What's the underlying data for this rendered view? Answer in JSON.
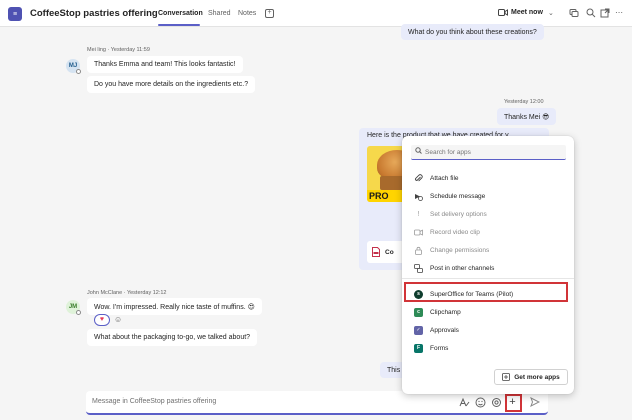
{
  "header": {
    "team_initial": "≡",
    "title": "CoffeeStop pastries offering",
    "tabs": [
      "Conversation",
      "Shared",
      "Notes"
    ],
    "meet_now": "Meet now"
  },
  "messages": {
    "top_mine": "What do you think about these creations?",
    "mei": {
      "initials": "MJ",
      "meta": "Mei ling  ·  Yesterday 11:59",
      "msg1": "Thanks Emma and team! This looks fantastic!",
      "msg2": "Do you have more details on the ingredients etc.?"
    },
    "reply": {
      "time": "Yesterday 12:00",
      "text": "Thanks Mei 😎"
    },
    "card": {
      "text": "Here is the product that we have created for y",
      "image_band": "PRO",
      "file_label": "Co"
    },
    "john": {
      "initials": "JM",
      "meta": "John McClane  ·  Yesterday 12:12",
      "msg1": "Wow. I'm impressed. Really nice taste of muffins. 😍",
      "reaction": "♥",
      "msg2": "What about the packaging to-go, we talked about?"
    },
    "partial_mine": "This"
  },
  "compose": {
    "placeholder": "Message in CoffeeStop pastries offering"
  },
  "popup": {
    "search_placeholder": "Search for apps",
    "actions": [
      {
        "label": "Attach file",
        "icon": "paperclip-icon",
        "disabled": false
      },
      {
        "label": "Schedule message",
        "icon": "schedule-icon",
        "disabled": false
      },
      {
        "label": "Set delivery options",
        "icon": "exclamation-icon",
        "disabled": true
      },
      {
        "label": "Record video clip",
        "icon": "video-icon",
        "disabled": true
      },
      {
        "label": "Change permissions",
        "icon": "lock-icon",
        "disabled": true
      },
      {
        "label": "Post in other channels",
        "icon": "channels-icon",
        "disabled": false
      }
    ],
    "apps": [
      {
        "label": "SuperOffice for Teams (Pilot)",
        "icon": "superoffice-icon",
        "color": "#0f3d2e"
      },
      {
        "label": "Clipchamp",
        "icon": "clipchamp-icon",
        "color": "#2e8b57"
      },
      {
        "label": "Approvals",
        "icon": "approvals-icon",
        "color": "#6264a7"
      },
      {
        "label": "Forms",
        "icon": "forms-icon",
        "color": "#077568"
      }
    ],
    "get_more": "Get more apps"
  },
  "colors": {
    "accent": "#5b5fc7",
    "highlight": "#d13438",
    "mine_bubble": "#e8ebfa"
  }
}
